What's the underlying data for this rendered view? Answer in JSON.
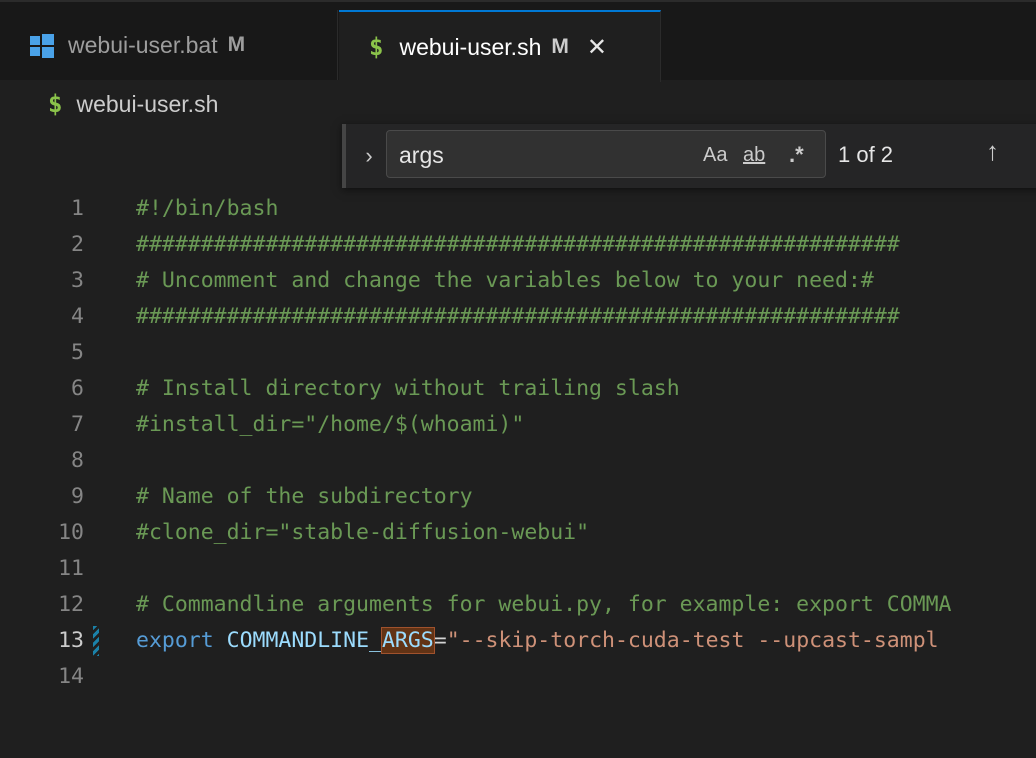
{
  "tabs": [
    {
      "label": "webui-user.bat",
      "modified": "M",
      "icon": "windows-icon",
      "active": false
    },
    {
      "label": "webui-user.sh",
      "modified": "M",
      "icon": "dollar-icon",
      "active": true,
      "close": "✕"
    }
  ],
  "breadcrumb": {
    "icon_glyph": "$",
    "label": "webui-user.sh"
  },
  "find": {
    "value": "args",
    "match_case": "Aa",
    "whole_word": "ab",
    "regex": ".*",
    "count": "1 of 2",
    "toggle_glyph": "›",
    "prev_glyph": "↑"
  },
  "editor": {
    "lines": [
      {
        "n": "1",
        "text": "#!/bin/bash"
      },
      {
        "n": "2",
        "text": "###########################################################"
      },
      {
        "n": "3",
        "text": "# Uncomment and change the variables below to your need:#"
      },
      {
        "n": "4",
        "text": "###########################################################"
      },
      {
        "n": "5",
        "text": ""
      },
      {
        "n": "6",
        "text": "# Install directory without trailing slash"
      },
      {
        "n": "7",
        "text": "#install_dir=\"/home/$(whoami)\""
      },
      {
        "n": "8",
        "text": ""
      },
      {
        "n": "9",
        "text": "# Name of the subdirectory"
      },
      {
        "n": "10",
        "text": "#clone_dir=\"stable-diffusion-webui\""
      },
      {
        "n": "11",
        "text": ""
      },
      {
        "n": "12",
        "text": "# Commandline arguments for webui.py, for example: export COMMA"
      },
      {
        "n": "13",
        "kw": "export",
        "var_a": "COMMANDLINE_",
        "var_hl": "ARGS",
        "eq": "=",
        "str": "\"--skip-torch-cuda-test --upcast-sampl"
      },
      {
        "n": "14",
        "text": ""
      }
    ]
  },
  "colors": {
    "accent": "#0078d4",
    "comment": "#6a9955",
    "keyword": "#569cd6",
    "string": "#ce9178",
    "variable": "#9cdcfe",
    "match_highlight": "#623315"
  }
}
